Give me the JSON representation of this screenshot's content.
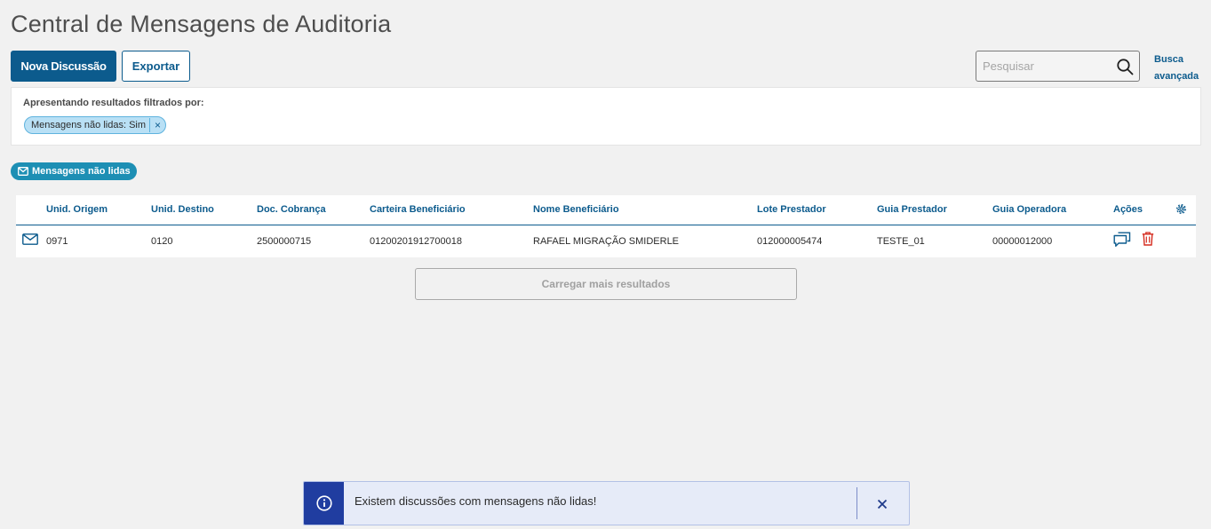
{
  "page": {
    "title": "Central de Mensagens de Auditoria"
  },
  "toolbar": {
    "new_discussion_label": "Nova Discussão",
    "export_label": "Exportar"
  },
  "search": {
    "placeholder": "Pesquisar",
    "value": "",
    "icon": "search-icon",
    "advanced_label_line1": "Busca",
    "advanced_label_line2": "avançada"
  },
  "filters": {
    "label": "Apresentando resultados filtrados por:",
    "chips": [
      {
        "label": "Mensagens não lidas: Sim",
        "close": "×"
      }
    ]
  },
  "unread_tag": {
    "label": "Mensagens não lidas",
    "icon": "envelope-icon"
  },
  "table": {
    "columns": [
      "Unid. Origem",
      "Unid. Destino",
      "Doc. Cobrança",
      "Carteira Beneficiário",
      "Nome Beneficiário",
      "Lote Prestador",
      "Guia Prestador",
      "Guia Operadora",
      "Ações"
    ],
    "rows": [
      {
        "unid_origem": "0971",
        "unid_destino": "0120",
        "doc_cobranca": "2500000715",
        "carteira": "01200201912700018",
        "nome": "RAFAEL MIGRAÇÃO SMIDERLE",
        "lote": "012000005474",
        "guia_prestador": "TESTE_01",
        "guia_operadora": "00000012000",
        "actions": [
          "chat-icon",
          "trash-icon"
        ]
      }
    ]
  },
  "load_more_label": "Carregar mais resultados",
  "toast": {
    "message": "Existem discussões com mensagens não lidas!",
    "icon": "info-icon",
    "close_icon": "close-icon"
  },
  "colors": {
    "primary": "#0c5b8d",
    "chip_bg": "#b9e0f5",
    "tag_bg": "#1d8fb4",
    "toast_side": "#203da0",
    "toast_bg": "#e6ebf8",
    "danger": "#d52b1e"
  }
}
